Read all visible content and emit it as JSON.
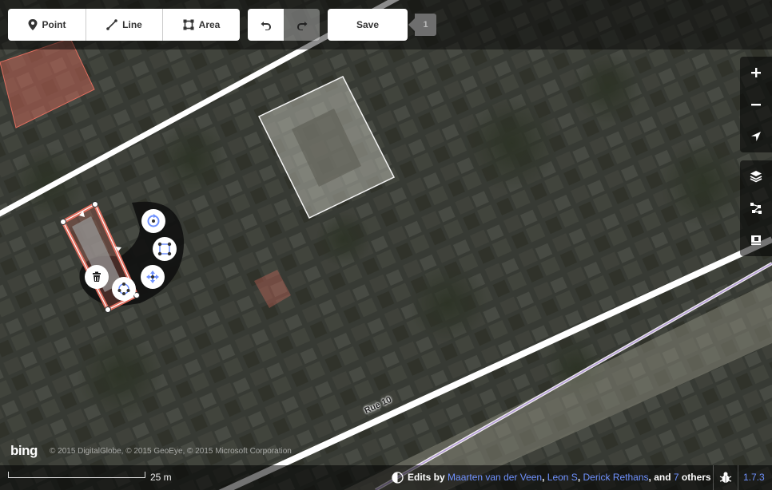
{
  "toolbar": {
    "point_label": "Point",
    "line_label": "Line",
    "area_label": "Area",
    "save_label": "Save",
    "save_count": "1"
  },
  "map": {
    "street_label": "Rue 10",
    "imagery_logo": "bing",
    "imagery_attribution": "© 2015 DigitalGlobe, © 2015 GeoEye, © 2015 Microsoft Corporation"
  },
  "radial_menu": {
    "items": [
      "delete-icon",
      "circularize-icon",
      "orthogonalize-icon",
      "move-icon",
      "rotate-icon"
    ]
  },
  "map_controls": {
    "zoom_in": "+",
    "zoom_out": "−",
    "icons": [
      "geolocate-icon",
      "layers-icon",
      "map-data-icon",
      "help-icon"
    ]
  },
  "footer": {
    "scale_label": "25 m",
    "edits_by_label": "Edits by",
    "contributors": [
      "Maarten van der Veen",
      "Leon S",
      "Derick Rethans"
    ],
    "and_label": "and",
    "others_count": "7",
    "others_label": "others",
    "version": "1.7.3"
  },
  "colors": {
    "accent": "#7092ff",
    "selected_area": "#e06e5f",
    "road": "#ffffff",
    "track": "#bca9e1"
  }
}
